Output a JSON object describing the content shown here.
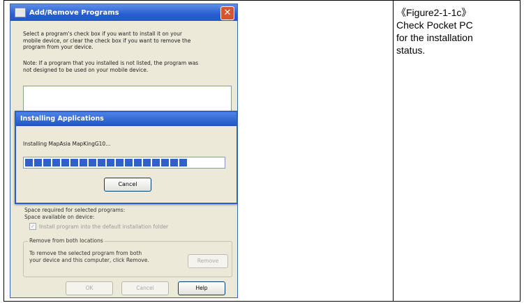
{
  "caption": {
    "lines": [
      "《Figure2-1-1c》",
      "Check Pocket PC",
      "for the installation",
      "status."
    ]
  },
  "dialog": {
    "title": "Add/Remove Programs",
    "close_symbol": "✕",
    "instruction_lines": [
      "Select a program's check box if you want to install it on your",
      "mobile device, or clear the check box if you want to remove the",
      "program from your device."
    ],
    "note_lines": [
      "Note:  If a program that you installed is not listed, the program was",
      "not designed to be used on your mobile device."
    ],
    "space_required": "Space required for selected programs:",
    "space_available": "Space available on device:",
    "default_location_checkbox": "Install program into the default installation folder",
    "remove_group": {
      "title": "Remove from both locations",
      "text_lines": [
        "To remove the selected program from both",
        "your device and this computer, click Remove."
      ],
      "remove_label": "Remove"
    },
    "buttons": {
      "ok": "OK",
      "cancel": "Cancel",
      "help": "Help"
    }
  },
  "progress_dialog": {
    "title": "Installing Applications",
    "status": "Installing MapAsia MapKingG10...",
    "progress": 0.82,
    "cancel_label": "Cancel"
  }
}
